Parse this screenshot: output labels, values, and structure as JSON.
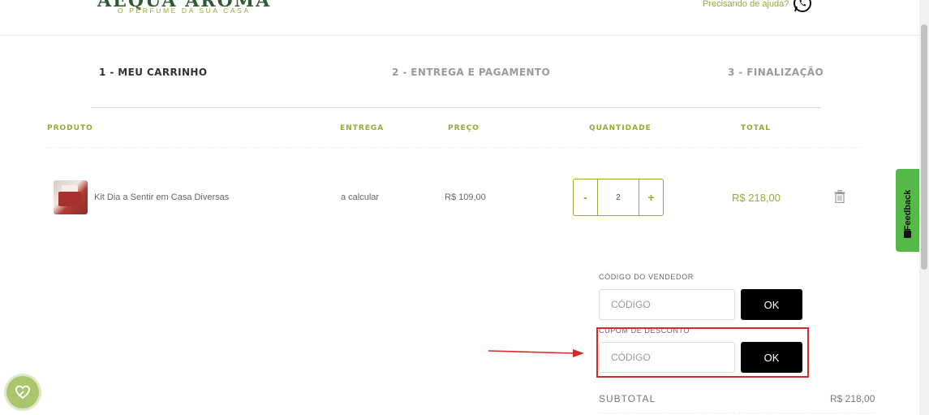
{
  "header": {
    "logo_text": "AEQUA AROMA",
    "tagline": "O PERFUME DA SUA CASA",
    "help_text": "Precisando de ajuda?",
    "whatsapp_icon": "whatsapp-icon"
  },
  "steps": [
    {
      "label": "1 - MEU CARRINHO",
      "active": true
    },
    {
      "label": "2 - ENTREGA E PAGAMENTO",
      "active": false
    },
    {
      "label": "3 - FINALIZAÇÃO",
      "active": false
    }
  ],
  "table": {
    "headers": [
      "PRODUTO",
      "ENTREGA",
      "PREÇO",
      "QUANTIDADE",
      "TOTAL"
    ],
    "rows": [
      {
        "product": "Kit Dia a Sentir em Casa Diversas",
        "delivery": "a calcular",
        "price": "R$ 109,00",
        "qty_minus": "-",
        "quantity": "2",
        "qty_plus": "+",
        "total": "R$ 218,00"
      }
    ]
  },
  "seller_code": {
    "label": "CÓDIGO DO VENDEDOR",
    "placeholder": "CÓDIGO",
    "button": "OK"
  },
  "coupon": {
    "label": "CUPOM DE DESCONTO",
    "placeholder": "CÓDIGO",
    "button": "OK"
  },
  "summary": {
    "subtotal_label": "SUBTOTAL",
    "subtotal_value": "R$ 218,00"
  },
  "feedback": {
    "label": "Feedback"
  },
  "colors": {
    "brand_green": "#8dae2e",
    "highlight_red": "#d62b2b",
    "feedback_green": "#55b947"
  }
}
